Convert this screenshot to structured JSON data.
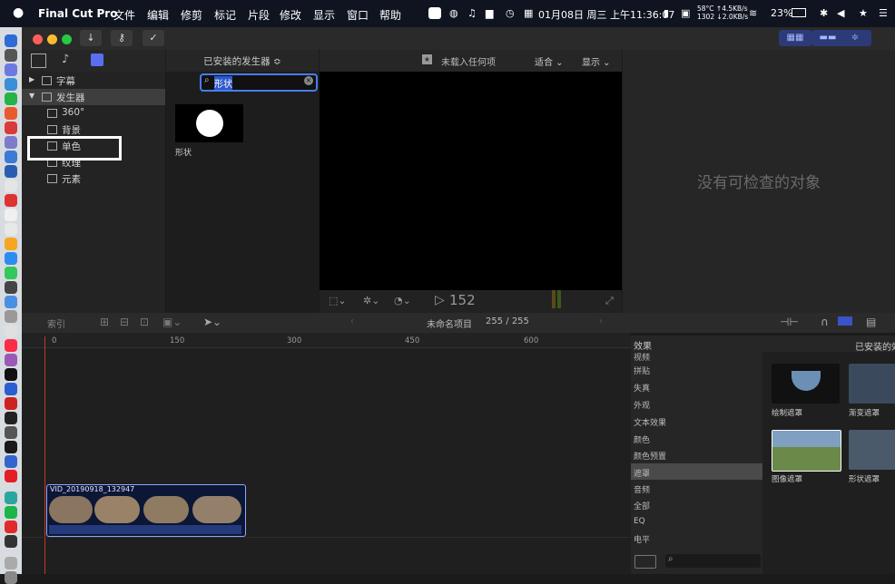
{
  "menubar": {
    "app_name": "Final Cut Pro",
    "items": [
      "文件",
      "编辑",
      "修剪",
      "标记",
      "片段",
      "修改",
      "显示",
      "窗口",
      "帮助"
    ],
    "datetime": "01月08日 周三 上午11:36:07",
    "cpu_temp": "58°C",
    "cpu_rpm": "1302",
    "net_up": "↑4.5KB/s",
    "net_down": "↓2.0KB/s",
    "battery": "23%"
  },
  "library": {
    "items": [
      {
        "label": "字幕",
        "level": 0,
        "expanded": false
      },
      {
        "label": "发生器",
        "level": 0,
        "expanded": true,
        "selected": true
      },
      {
        "label": "360°",
        "level": 1
      },
      {
        "label": "背景",
        "level": 1
      },
      {
        "label": "单色",
        "level": 1,
        "highlighted": true
      },
      {
        "label": "纹理",
        "level": 1
      },
      {
        "label": "元素",
        "level": 1
      }
    ]
  },
  "browser": {
    "title": "已安装的发生器 ≎",
    "search_value": "形状",
    "result_label": "形状"
  },
  "viewer": {
    "status": "未载入任何项",
    "fit_label": "适合 ⌄",
    "display_label": "显示 ⌄",
    "frame_count": "152"
  },
  "inspector": {
    "empty_message": "没有可检查的对象"
  },
  "timeline": {
    "index_label": "索引",
    "project_name": "未命名项目",
    "duration": "255 / 255",
    "ruler": [
      "0",
      "150",
      "300",
      "450",
      "600"
    ],
    "clip_name": "VID_20190918_132947"
  },
  "effects": {
    "header": "效果",
    "categories": [
      "视频",
      "拼贴",
      "失真",
      "外观",
      "文本效果",
      "颜色",
      "颜色预置",
      "遮罩",
      "音频",
      "全部",
      "EQ",
      "电平"
    ],
    "selected_category": "遮罩",
    "installed_title": "已安装的效",
    "thumbs": [
      {
        "label": "绘制遮罩"
      },
      {
        "label": "渐变遮罩"
      },
      {
        "label": "图像遮罩"
      },
      {
        "label": "形状遮罩"
      }
    ]
  },
  "colors": {
    "accent": "#4f6bf5",
    "highlight_box": "#ffffff",
    "clip_border": "#8fa8ff"
  }
}
